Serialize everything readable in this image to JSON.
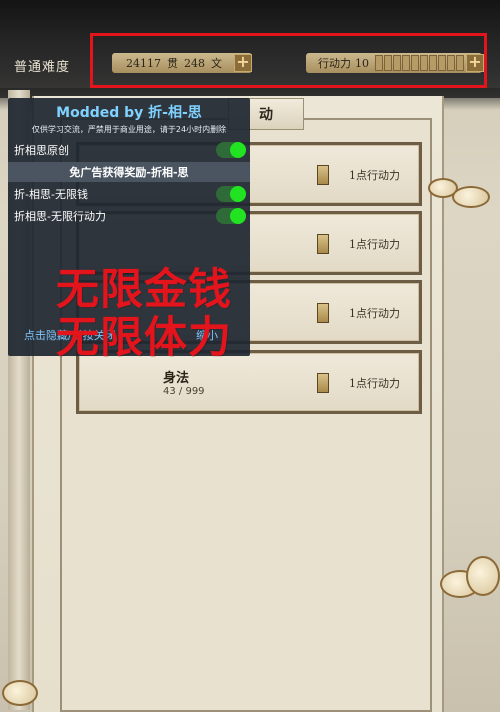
{
  "header": {
    "difficulty": "普通难度",
    "money": {
      "amount1": "24117",
      "unit1": "贯",
      "amount2": "248",
      "unit2": "文"
    },
    "energy": {
      "label": "行动力",
      "value": "10"
    },
    "plus": "+"
  },
  "tab": {
    "label": "动"
  },
  "skills": [
    {
      "name": "",
      "progress": "",
      "cost": "1点行动力"
    },
    {
      "name": "",
      "progress": "",
      "cost": "1点行动力"
    },
    {
      "name": "",
      "progress": "",
      "cost": "1点行动力"
    },
    {
      "name": "身法",
      "progress": "43 / 999",
      "cost": "1点行动力"
    }
  ],
  "mod_panel": {
    "title": "Modded by 折-相-思",
    "note": "仅供学习交流，严禁用于商业用途，请于24小时内删除",
    "item1": "折相思原创",
    "section": "免广告获得奖励-折相-思",
    "item2": "折-相思-无限钱",
    "item3": "折相思-无限行动力",
    "footer": "点击隐藏/长按关闭",
    "footer_right": "缩小"
  },
  "overlay": {
    "line1": "无限金钱",
    "line2": "无限体力"
  },
  "colors": {
    "highlight_red": "#e3141c",
    "toggle_green": "#22e322",
    "panel_title_blue": "#7fd1ff"
  }
}
